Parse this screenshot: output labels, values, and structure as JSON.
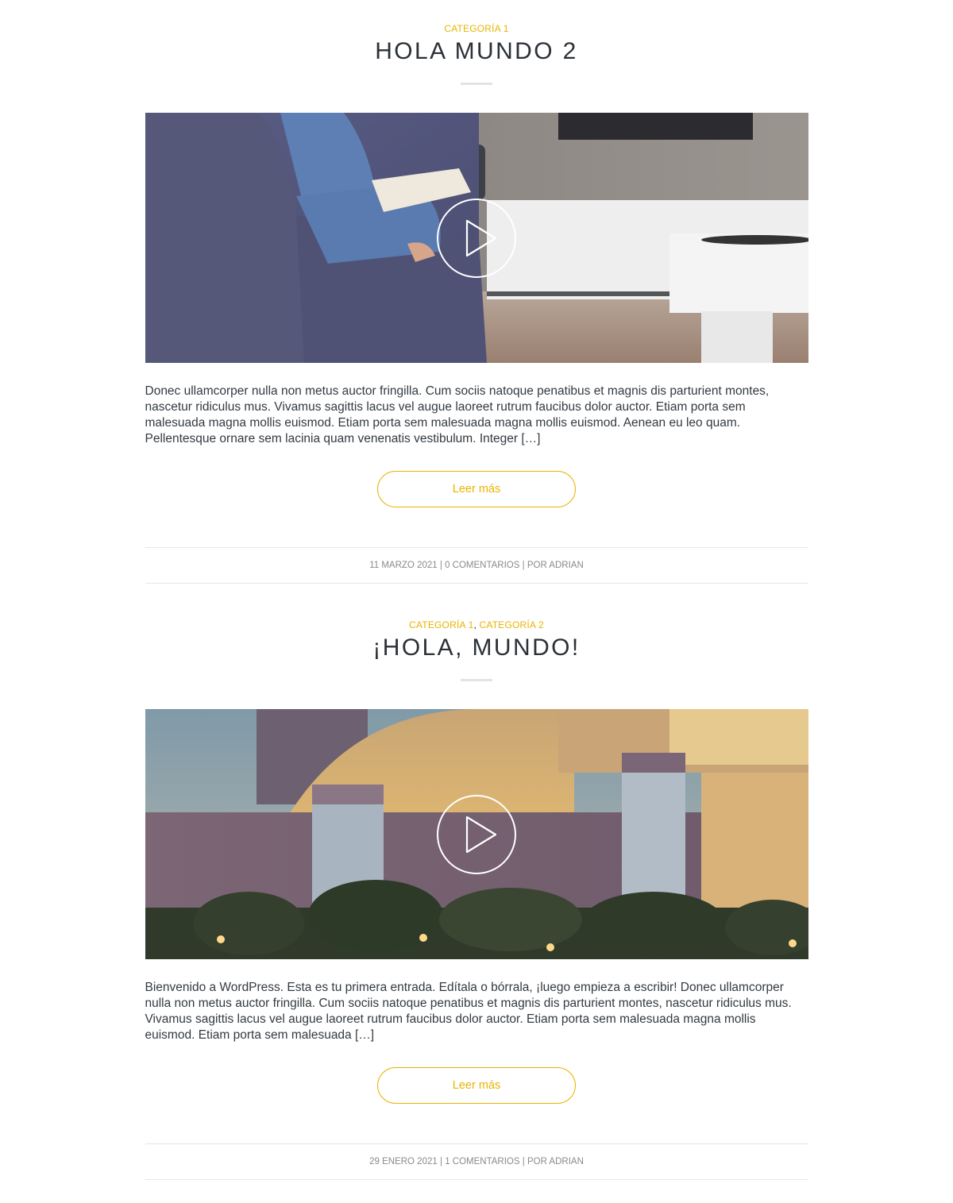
{
  "posts": [
    {
      "categories": [
        "Categoría 1"
      ],
      "title": "Hola mundo 2",
      "excerpt": "Donec ullamcorper nulla non metus auctor fringilla. Cum sociis natoque penatibus et magnis dis parturient montes, nascetur ridiculus mus. Vivamus sagittis lacus vel augue laoreet rutrum faucibus dolor auctor. Etiam porta sem malesuada magna mollis euismod. Etiam porta sem malesuada magna mollis euismod. Aenean eu leo quam. Pellentesque ornare sem lacinia quam venenatis vestibulum. Integer […]",
      "read_more": "Leer más",
      "date": "11 marzo 2021",
      "meta_sep": "|",
      "comments": "0 Comentarios",
      "author": "por adrian",
      "image_icon": "play-icon"
    },
    {
      "categories": [
        "Categoría 1",
        "Categoría 2"
      ],
      "category_sep": ",",
      "title": "¡Hola, mundo!",
      "excerpt": "Bienvenido a WordPress. Esta es tu primera entrada. Edítala o bórrala, ¡luego empieza a escribir! Donec ullamcorper nulla non metus auctor fringilla. Cum sociis natoque penatibus et magnis dis parturient montes, nascetur ridiculus mus. Vivamus sagittis lacus vel augue laoreet rutrum faucibus dolor auctor. Etiam porta sem malesuada magna mollis euismod. Etiam porta sem malesuada […]",
      "read_more": "Leer más",
      "date": "29 enero 2021",
      "meta_sep": "|",
      "comments": "1 Comentarios",
      "author": "por adrian",
      "image_icon": "play-icon"
    }
  ],
  "colors": {
    "accent": "#e8b400",
    "title": "#2b3137",
    "body_text": "#333a40",
    "meta_text": "#8a8a8a",
    "divider": "#e6e6e6"
  }
}
